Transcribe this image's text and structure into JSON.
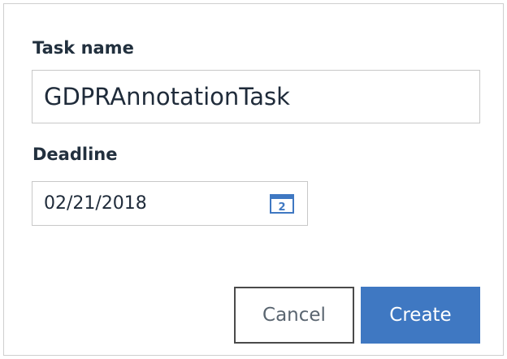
{
  "form": {
    "task_name_label": "Task name",
    "task_name_value": "GDPRAnnotationTask",
    "deadline_label": "Deadline",
    "deadline_value": "02/21/2018",
    "calendar_icon": "calendar-icon",
    "calendar_day": "2"
  },
  "actions": {
    "cancel_label": "Cancel",
    "create_label": "Create"
  },
  "colors": {
    "primary": "#3f78c2",
    "label_text": "#22303e",
    "border": "#c8c8c8"
  }
}
